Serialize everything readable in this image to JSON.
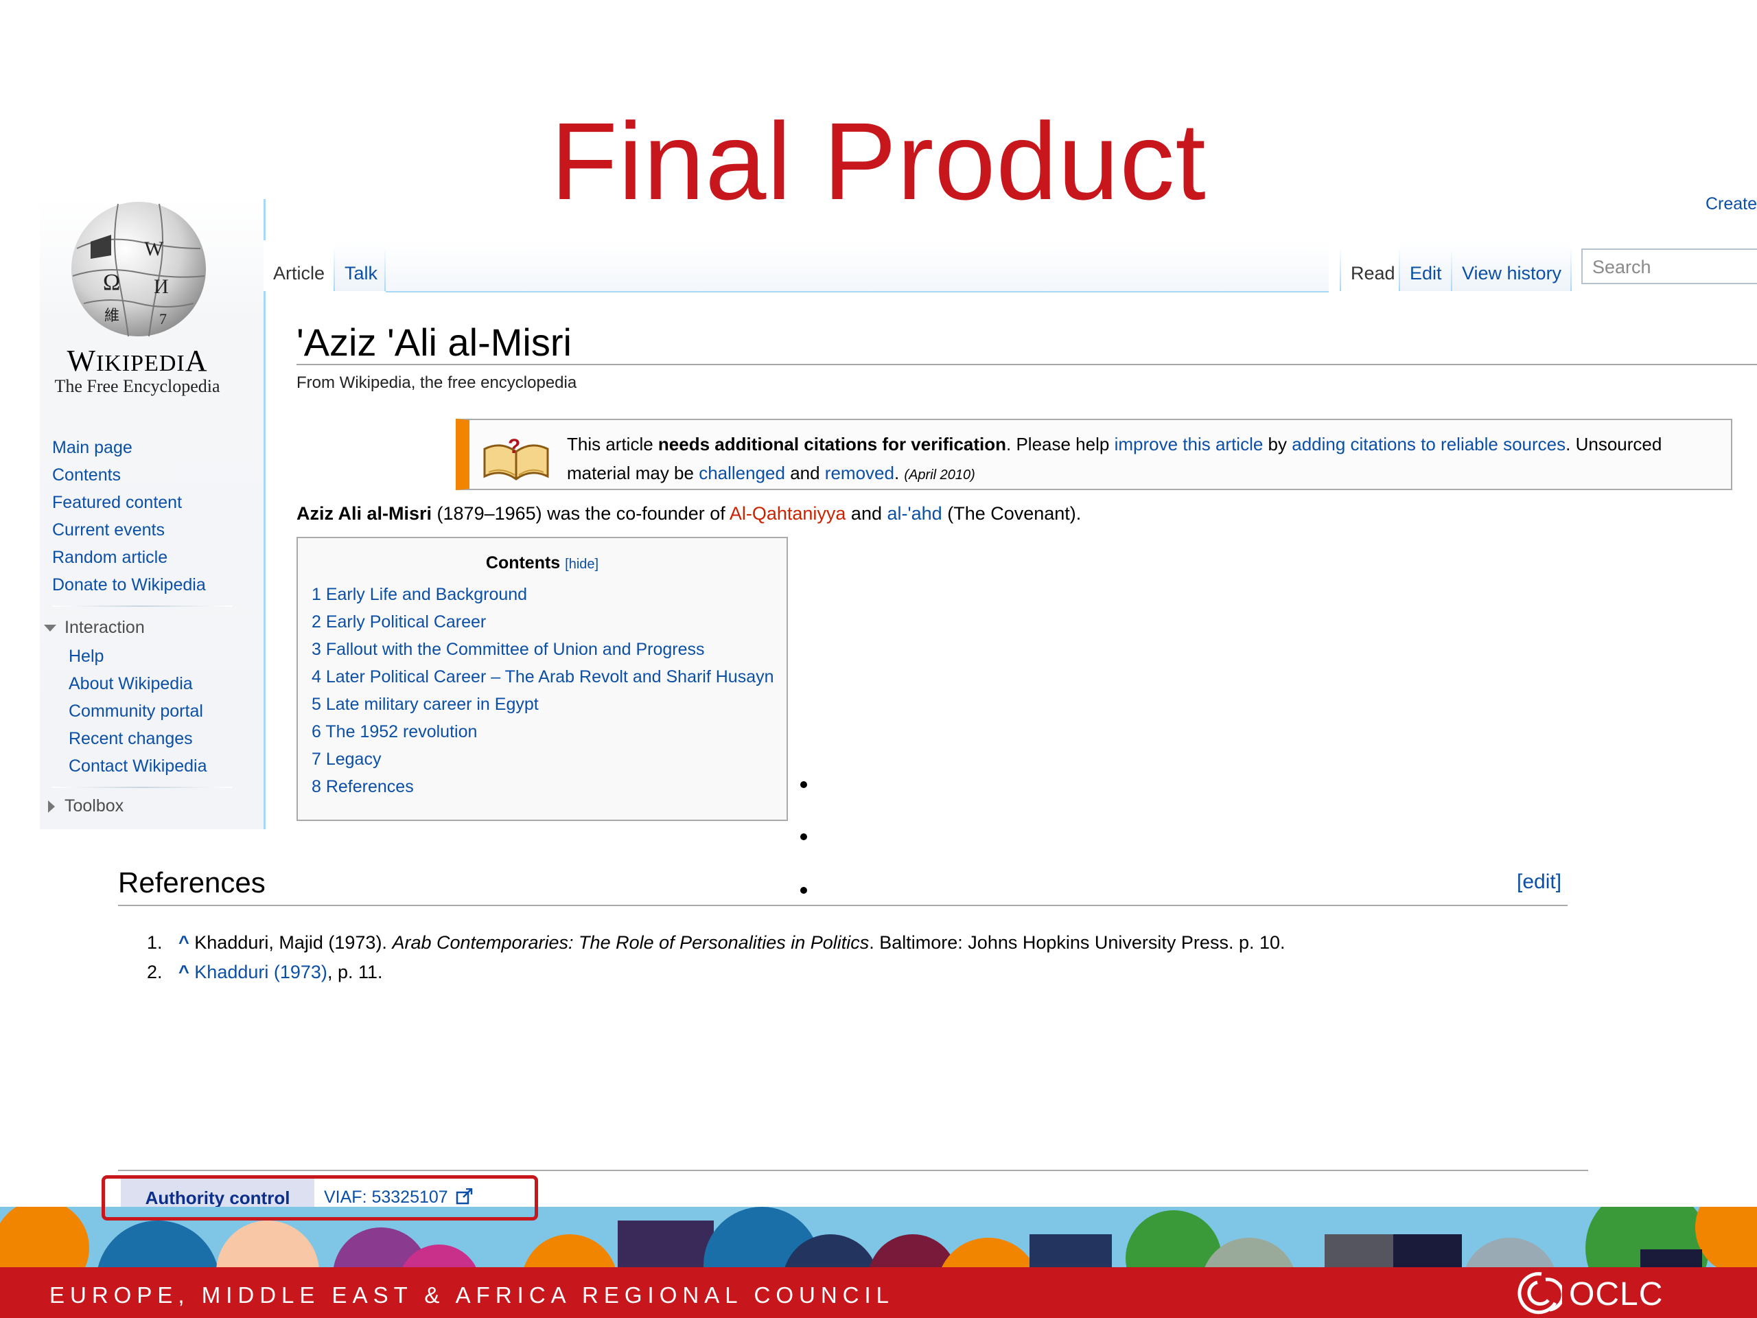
{
  "slide": {
    "title": "Final Product"
  },
  "header": {
    "create_link": "Create"
  },
  "logo": {
    "wordmark": "Wikipedia",
    "tagline": "The Free Encyclopedia"
  },
  "sidebar": {
    "nav": [
      "Main page",
      "Contents",
      "Featured content",
      "Current events",
      "Random article",
      "Donate to Wikipedia"
    ],
    "interaction": {
      "heading": "Interaction",
      "items": [
        "Help",
        "About Wikipedia",
        "Community portal",
        "Recent changes",
        "Contact Wikipedia"
      ]
    },
    "toolbox": "Toolbox"
  },
  "tabs": {
    "article": "Article",
    "talk": "Talk",
    "read": "Read",
    "edit": "Edit",
    "history": "View history"
  },
  "search": {
    "placeholder": "Search"
  },
  "article": {
    "title": "'Aziz 'Ali al-Misri",
    "from": "From Wikipedia, the free encyclopedia",
    "notice": {
      "t1": "This article ",
      "bold": "needs additional citations for verification",
      "t2": ". Please help ",
      "link1": "improve this article",
      "t3": " by ",
      "link2": "adding citations to reliable sources",
      "t4": ". Unsourced material may be ",
      "link3": "challenged",
      "t5": " and ",
      "link4": "removed",
      "t6": ". ",
      "date": "(April 2010)"
    },
    "lead": {
      "name": "Aziz Ali al-Misri",
      "t1": " (1879–1965) was the co-founder of ",
      "link1": "Al-Qahtaniyya",
      "t2": " and ",
      "link2": "al-'ahd",
      "t3": " (The Covenant)."
    }
  },
  "toc": {
    "title": "Contents",
    "hide": "[hide]",
    "items": [
      "1 Early Life and Background",
      "2 Early Political Career",
      "3 Fallout with the Committee of Union and Progress",
      "4 Later Political Career – The Arab Revolt and Sharif Husayn",
      "5 Late military career in Egypt",
      "6 The 1952 revolution",
      "7 Legacy",
      "8 References"
    ]
  },
  "references": {
    "heading": "References",
    "edit": "[edit]",
    "items": [
      {
        "num": "1.",
        "caret": "^",
        "a": " Khadduri, Majid (1973). ",
        "italic": "Arab Contemporaries: The Role of Personalities in Politics",
        "b": ". Baltimore: Johns Hopkins University Press. p. 10."
      },
      {
        "num": "2.",
        "caret": "^",
        "link": "Khadduri (1973)",
        "b": ", p. 11."
      }
    ]
  },
  "authority": {
    "label": "Authority control",
    "value": "VIAF: 53325107"
  },
  "footer": {
    "text": "EUROPE, MIDDLE EAST & AFRICA REGIONAL COUNCIL",
    "logo_text": "OCLC"
  },
  "colors": {
    "brand_red": "#c8161d",
    "link_blue": "#0b4fa6",
    "notice_orange": "#f28500"
  },
  "icons": [
    "globe-puzzle-logo",
    "open-book-question-icon",
    "external-link-icon",
    "oclc-logo"
  ]
}
